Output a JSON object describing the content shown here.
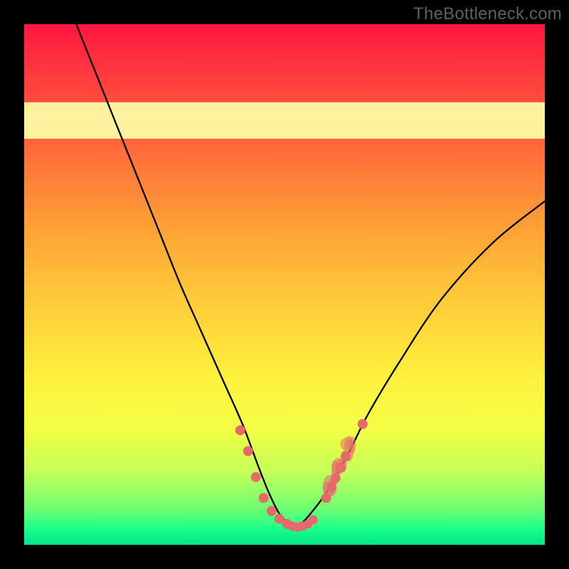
{
  "attribution": "TheBottleneck.com",
  "chart_data": {
    "type": "line",
    "title": "",
    "xlabel": "",
    "ylabel": "",
    "xlim": [
      0,
      100
    ],
    "ylim": [
      0,
      100
    ],
    "curve": {
      "x": [
        10,
        14,
        18,
        22,
        26,
        30,
        34,
        38,
        42,
        45,
        47,
        49,
        51,
        53,
        55,
        58,
        62,
        66,
        72,
        80,
        90,
        100
      ],
      "y": [
        100,
        90,
        80,
        70,
        60,
        50,
        41,
        32,
        23,
        15,
        10,
        6,
        4,
        4,
        6,
        10,
        17,
        25,
        35,
        47,
        58,
        66
      ]
    },
    "highlight_band": {
      "y0": 78,
      "y1": 85
    },
    "dots_left": [
      {
        "x": 41.5,
        "y": 22
      },
      {
        "x": 43,
        "y": 18
      },
      {
        "x": 44.5,
        "y": 13
      },
      {
        "x": 46,
        "y": 9
      },
      {
        "x": 47.5,
        "y": 6.5
      },
      {
        "x": 49,
        "y": 5
      },
      {
        "x": 50.5,
        "y": 4
      }
    ],
    "dots_bottom": [
      {
        "x": 51.5,
        "y": 3.6
      },
      {
        "x": 52.5,
        "y": 3.4
      },
      {
        "x": 53.5,
        "y": 3.6
      },
      {
        "x": 54.5,
        "y": 4
      },
      {
        "x": 55.5,
        "y": 4.8
      }
    ],
    "dots_right": [
      {
        "x": 58,
        "y": 9
      },
      {
        "x": 59,
        "y": 11
      },
      {
        "x": 59.8,
        "y": 12.8
      },
      {
        "x": 60.8,
        "y": 14.8
      },
      {
        "x": 61.8,
        "y": 17
      },
      {
        "x": 65,
        "y": 23.2
      }
    ],
    "flame_region": {
      "x0": 58,
      "x1": 63,
      "y0": 10,
      "y1": 20
    }
  }
}
